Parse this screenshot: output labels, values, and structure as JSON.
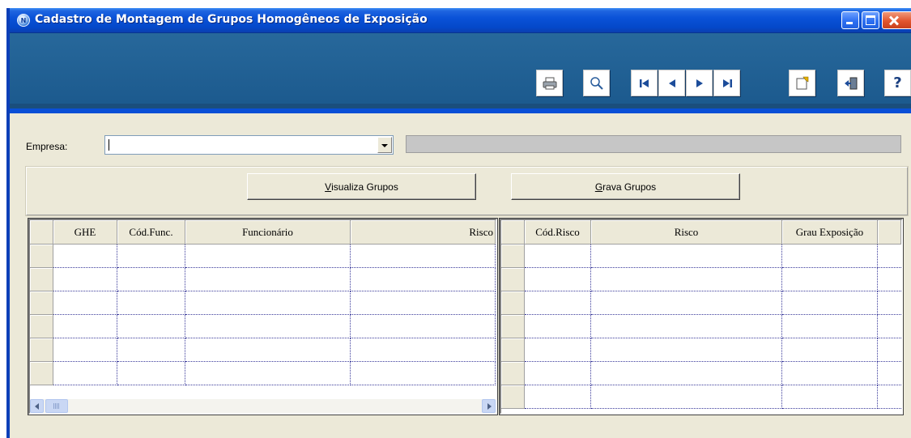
{
  "window": {
    "title": "Cadastro de Montagem de Grupos Homogêneos de Exposição",
    "app_icon_text": "N"
  },
  "toolbar": {
    "buttons": [
      "printer-icon",
      "search-icon",
      "first-record-icon",
      "previous-record-icon",
      "next-record-icon",
      "last-record-icon",
      "edit-note-icon",
      "exit-icon",
      "help-icon"
    ],
    "help_label": "?"
  },
  "form": {
    "empresa_label": "Empresa:",
    "empresa_value": "",
    "empresa_name": ""
  },
  "actions": {
    "visualiza_label_prefix": "V",
    "visualiza_label_rest": "isualiza Grupos",
    "grava_label_prefix": "G",
    "grava_label_rest": "rava Grupos"
  },
  "grid_left": {
    "columns": [
      "GHE",
      "Cód.Func.",
      "Funcionário",
      "Risco"
    ],
    "rows": [
      [
        "",
        "",
        "",
        ""
      ],
      [
        "",
        "",
        "",
        ""
      ],
      [
        "",
        "",
        "",
        ""
      ],
      [
        "",
        "",
        "",
        ""
      ],
      [
        "",
        "",
        "",
        ""
      ],
      [
        "",
        "",
        "",
        ""
      ]
    ]
  },
  "grid_right": {
    "columns": [
      "Cód.Risco",
      "Risco",
      "Grau Exposição"
    ],
    "rows": [
      [
        "",
        "",
        ""
      ],
      [
        "",
        "",
        ""
      ],
      [
        "",
        "",
        ""
      ],
      [
        "",
        "",
        ""
      ],
      [
        "",
        "",
        ""
      ],
      [
        "",
        "",
        ""
      ],
      [
        "",
        "",
        ""
      ]
    ]
  },
  "colors": {
    "titlebar": "#0a52d8",
    "toolbar": "#1f5e92",
    "client_bg": "#ece9d8"
  }
}
